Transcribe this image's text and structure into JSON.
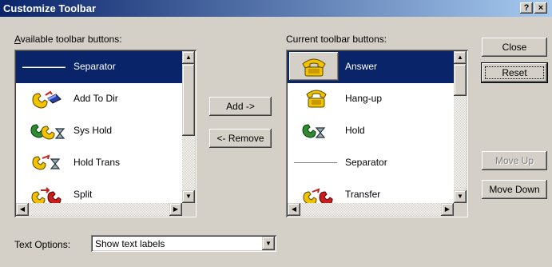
{
  "window": {
    "title": "Customize Toolbar",
    "help_label": "?",
    "close_label": "×"
  },
  "available": {
    "label": "Available toolbar buttons:",
    "items": [
      {
        "label": "Separator",
        "icon": "separator-line"
      },
      {
        "label": "Add To Dir",
        "icon": "phone-book-icon"
      },
      {
        "label": "Sys Hold",
        "icon": "system-hold-icon"
      },
      {
        "label": "Hold Trans",
        "icon": "hold-transfer-icon"
      },
      {
        "label": "Split",
        "icon": "split-call-icon"
      }
    ]
  },
  "current": {
    "label": "Current toolbar buttons:",
    "items": [
      {
        "label": "Answer",
        "icon": "answer-phone-icon"
      },
      {
        "label": "Hang-up",
        "icon": "hangup-phone-icon"
      },
      {
        "label": "Hold",
        "icon": "hold-call-icon"
      },
      {
        "label": "Separator",
        "icon": "separator-line"
      },
      {
        "label": "Transfer",
        "icon": "transfer-call-icon"
      }
    ]
  },
  "buttons": {
    "add": "Add ->",
    "remove": "<- Remove",
    "close": "Close",
    "reset": "Reset",
    "move_up": "Move Up",
    "move_down": "Move Down"
  },
  "text_options": {
    "label": "Text Options:",
    "value": "Show text labels"
  },
  "colors": {
    "selection": "#0a246a",
    "face": "#d4d0c8",
    "phone_yellow": "#f2c200",
    "phone_green": "#2e8b2e",
    "phone_red": "#c81e1e"
  }
}
